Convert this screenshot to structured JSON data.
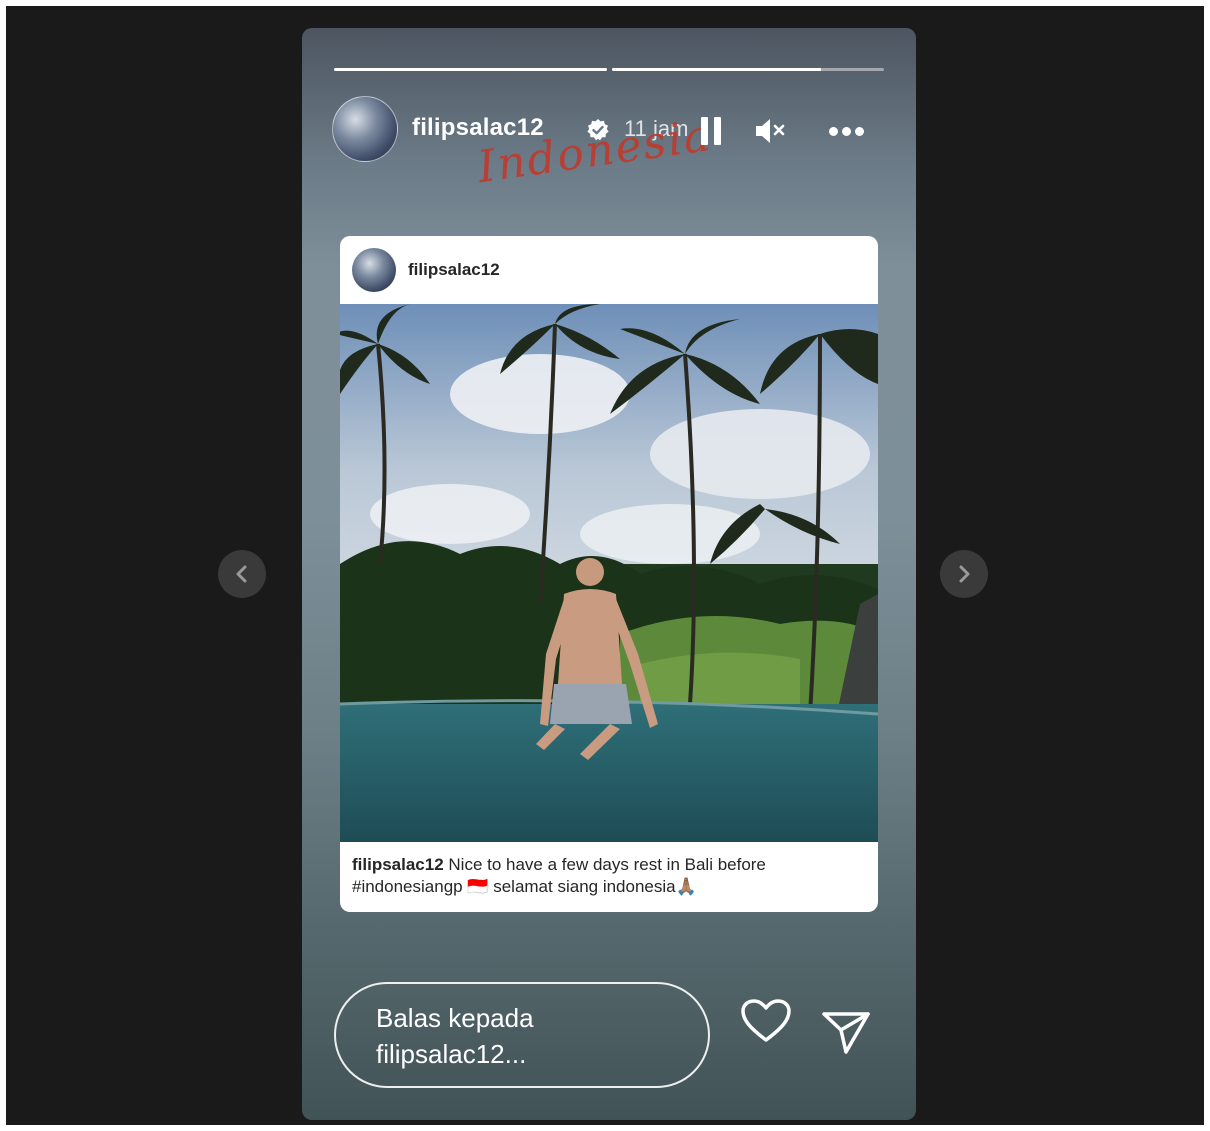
{
  "story": {
    "progress": [
      1.0,
      0.77
    ],
    "username": "filipsalac12",
    "time": "11 jam",
    "overlay_text": "Indonesia"
  },
  "post": {
    "username": "filipsalac12",
    "caption_user": "filipsalac12",
    "caption_line1": " Nice to have a few days rest in Bali before",
    "caption_line2": "#indonesiangp 🇮🇩 selamat siang indonesia🙏🏽"
  },
  "reply": {
    "placeholder_line1": "Balas kepada",
    "placeholder_line2": "filipsalac12..."
  },
  "icons": {
    "verified": "verified-badge-icon",
    "pause": "pause-icon",
    "mute": "mute-icon",
    "more": "more-options-icon",
    "prev": "chevron-left-icon",
    "next": "chevron-right-icon",
    "like": "heart-icon",
    "share": "send-icon"
  },
  "colors": {
    "viewer_bg": "#1a1a1a",
    "overlay_text": "#c0392b"
  }
}
